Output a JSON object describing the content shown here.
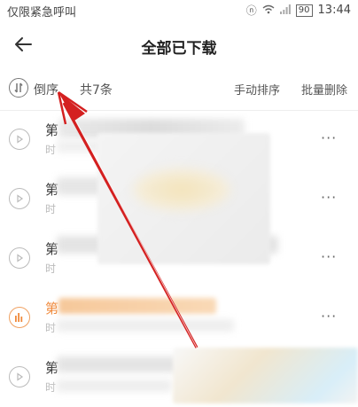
{
  "status_bar": {
    "left_text": "仅限紧急呼叫",
    "battery": "90",
    "time": "13:44"
  },
  "header": {
    "title": "全部已下载",
    "back_icon": "arrow-left-icon"
  },
  "toolbar": {
    "sort_label": "倒序",
    "count_label": "共7条",
    "manual_sort_label": "手动排序",
    "batch_delete_label": "批量删除"
  },
  "list": {
    "items": [
      {
        "title_prefix": "第",
        "subtitle_prefix": "时",
        "more": "···"
      },
      {
        "title_prefix": "第",
        "subtitle_prefix": "时",
        "more": "···"
      },
      {
        "title_prefix": "第",
        "subtitle_prefix": "时",
        "more": "···"
      },
      {
        "title_prefix": "第",
        "subtitle_prefix": "时",
        "more": "···"
      },
      {
        "title_prefix": "第",
        "subtitle_prefix": "时",
        "more": "···"
      }
    ]
  },
  "colors": {
    "accent": "#f08a3c",
    "arrow": "#d42020"
  }
}
